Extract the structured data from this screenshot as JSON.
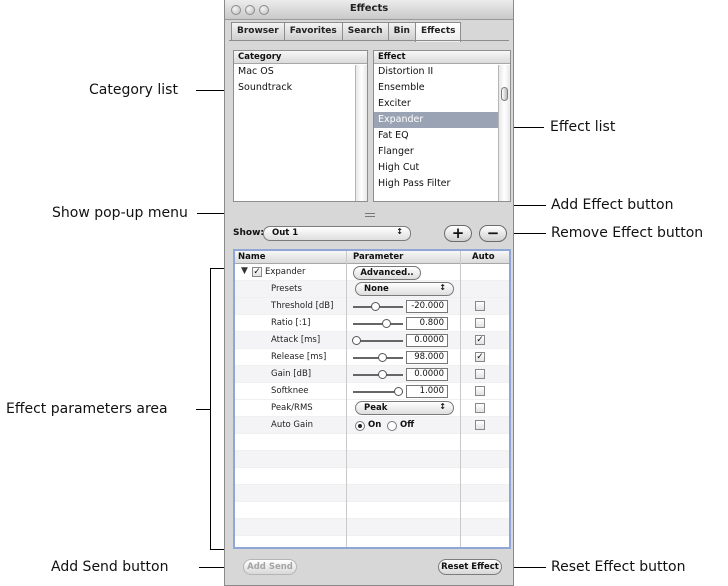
{
  "window": {
    "title": "Effects"
  },
  "tabs": [
    "Browser",
    "Favorites",
    "Search",
    "Bin",
    "Effects"
  ],
  "active_tab": "Effects",
  "category_list": {
    "header": "Category",
    "items": [
      "Mac OS",
      "Soundtrack"
    ]
  },
  "effect_list": {
    "header": "Effect",
    "items": [
      "Distortion II",
      "Ensemble",
      "Exciter",
      "Expander",
      "Fat EQ",
      "Flanger",
      "High Cut",
      "High Pass Filter"
    ],
    "selected": "Expander"
  },
  "show": {
    "label": "Show:",
    "value": "Out 1"
  },
  "buttons": {
    "add_effect": "+",
    "remove_effect": "−",
    "add_send": "Add Send",
    "reset_effect": "Reset Effect"
  },
  "params_table": {
    "headers": {
      "name": "Name",
      "parameter": "Parameter",
      "auto": "Auto"
    },
    "effect_name": "Expander",
    "advanced": "Advanced..",
    "presets": {
      "name": "Presets",
      "value": "None"
    },
    "rows": [
      {
        "name": "Threshold [dB]",
        "value": "-20.000",
        "slider": 0.45,
        "auto": false
      },
      {
        "name": "Ratio [:1]",
        "value": "0.800",
        "slider": 0.72,
        "auto": false
      },
      {
        "name": "Attack [ms]",
        "value": "0.0000",
        "slider": 0.0,
        "auto": true
      },
      {
        "name": "Release [ms]",
        "value": "98.000",
        "slider": 0.62,
        "auto": true
      },
      {
        "name": "Gain [dB]",
        "value": "0.0000",
        "slider": 0.62,
        "auto": false
      },
      {
        "name": "Softknee",
        "value": "1.000",
        "slider": 1.0,
        "auto": false
      }
    ],
    "peak_rms": {
      "name": "Peak/RMS",
      "value": "Peak"
    },
    "auto_gain": {
      "name": "Auto Gain",
      "on_label": "On",
      "off_label": "Off",
      "selected": "On"
    }
  },
  "callouts": {
    "category_list": "Category list",
    "effect_list": "Effect list",
    "show_popup": "Show pop-up menu",
    "add_effect": "Add Effect button",
    "remove_effect": "Remove Effect button",
    "params_area": "Effect parameters area",
    "add_send": "Add Send button",
    "reset_effect": "Reset Effect button"
  }
}
